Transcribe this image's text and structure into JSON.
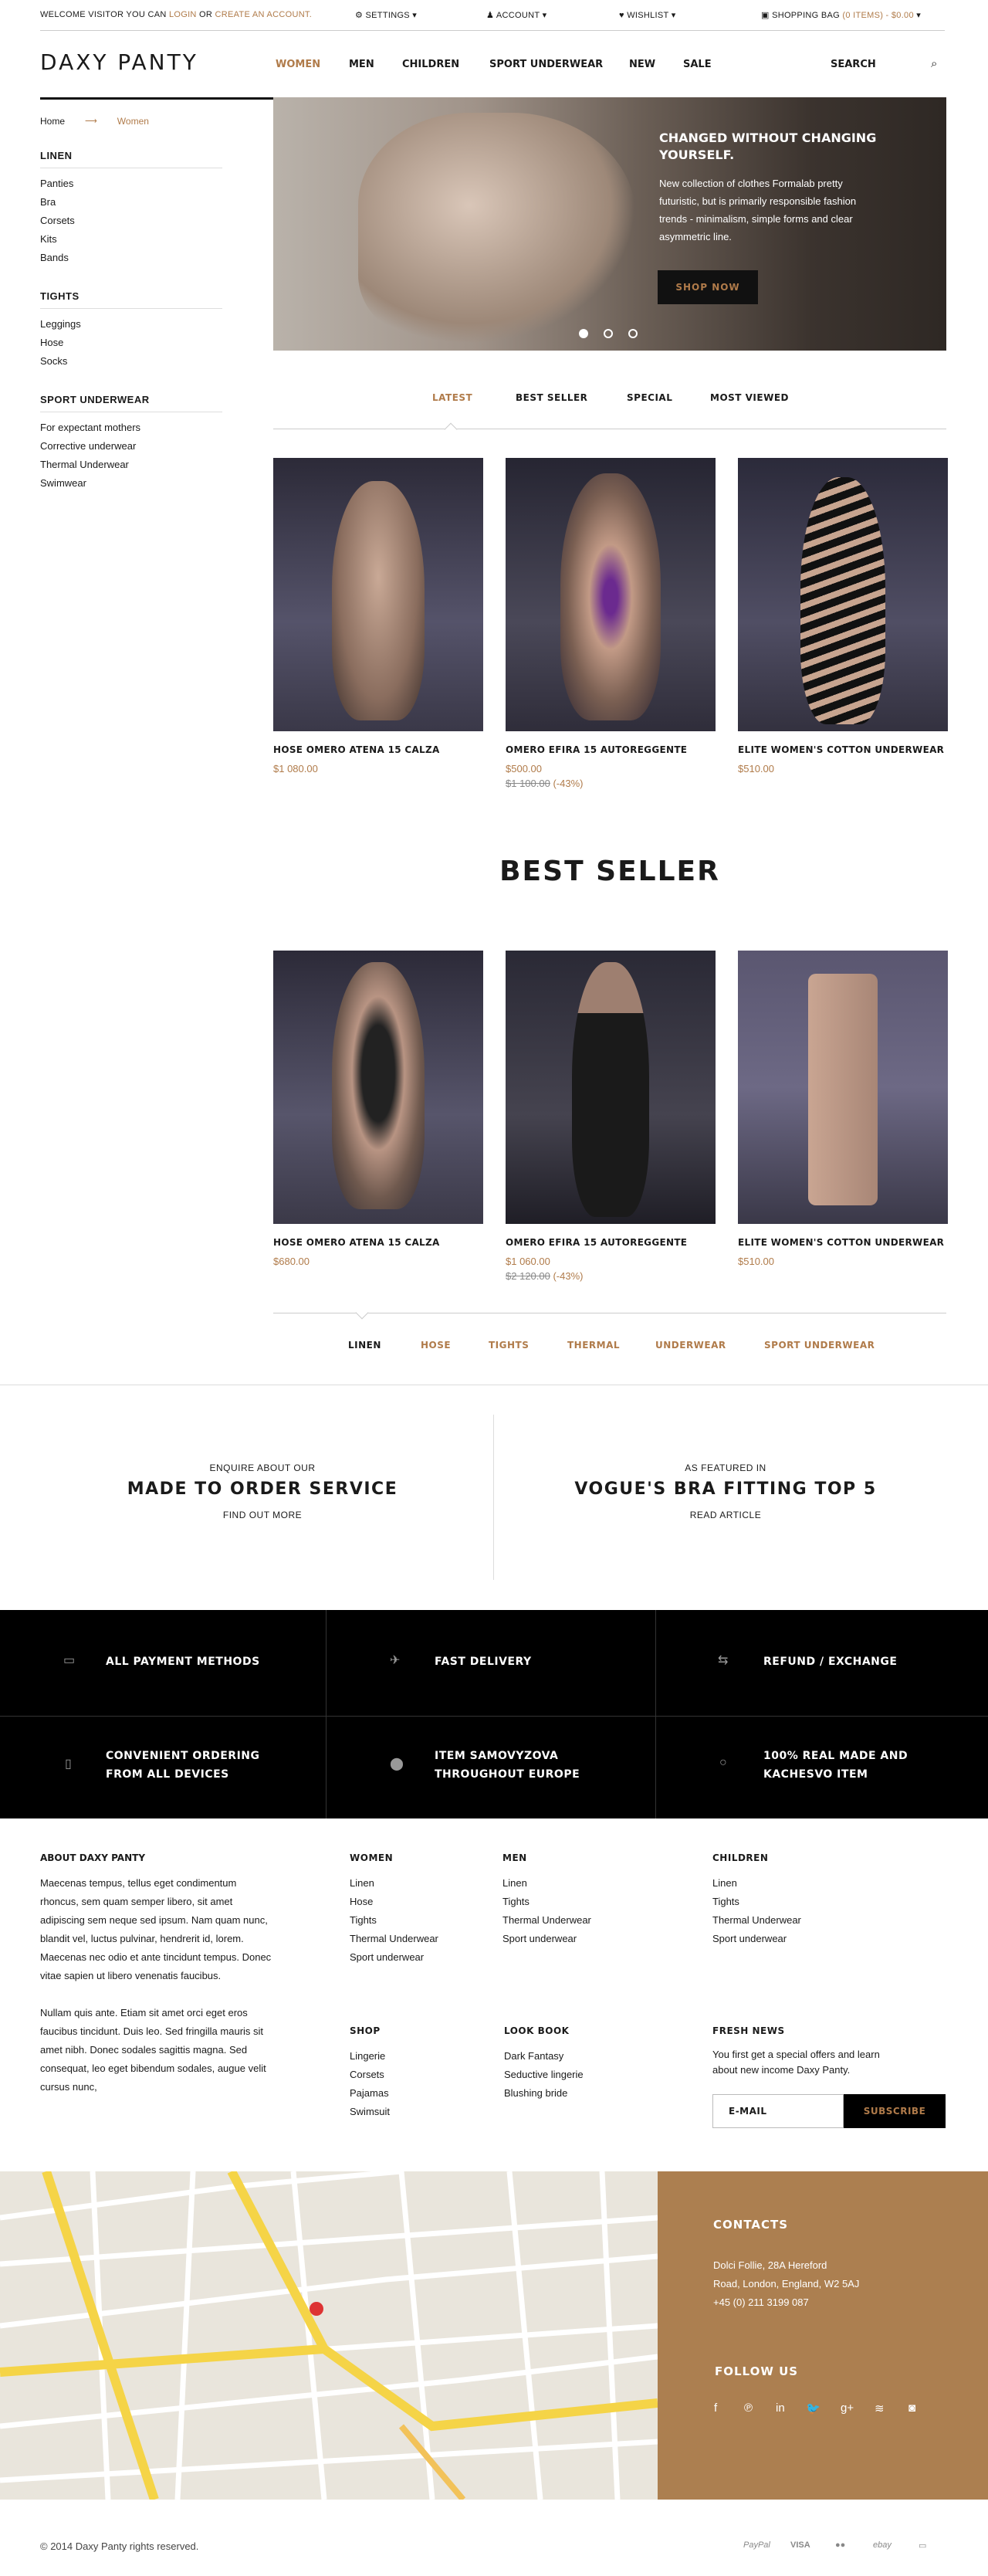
{
  "topbar": {
    "welcome": "WELCOME VISITOR YOU CAN ",
    "login": "LOGIN",
    "or": " OR ",
    "create": "CREATE AN ACCOUNT.",
    "settings": "SETTINGS",
    "account": "ACCOUNT",
    "wishlist": "WISHLIST",
    "bag": "SHOPPING BAG",
    "bag_count": "0 ITEMS) - $0.00"
  },
  "brand": "DAXY PANTY",
  "nav": [
    "WOMEN",
    "MEN",
    "CHILDREN",
    "SPORT UNDERWEAR",
    "NEW",
    "SALE"
  ],
  "search": "SEARCH",
  "breadcrumb": {
    "home": "Home",
    "current": "Women"
  },
  "sidebar": [
    {
      "title": "LINEN",
      "items": [
        "Panties",
        "Bra",
        "Corsets",
        "Kits",
        "Bands"
      ]
    },
    {
      "title": "TIGHTS",
      "items": [
        "Leggings",
        "Hose",
        "Socks"
      ]
    },
    {
      "title": "SPORT UNDERWEAR",
      "items": [
        "For expectant mothers",
        "Corrective underwear",
        "Thermal Underwear",
        "Swimwear"
      ]
    }
  ],
  "hero": {
    "title": "CHANGED WITHOUT CHANGING YOURSELF.",
    "text": "New collection of clothes Formalab pretty futuristic, but is primarily responsible fashion trends - minimalism, simple forms and clear asymmetric line.",
    "button": "SHOP NOW"
  },
  "tabs": [
    "LATEST",
    "BEST SELLER",
    "SPECIAL",
    "MOST VIEWED"
  ],
  "latest": [
    {
      "name": "HOSE OMERO ATENA 15 CALZA",
      "price": "$1 080.00",
      "old": "",
      "discount": ""
    },
    {
      "name": "OMERO EFIRA 15 AUTOREGGENTE",
      "price": "$500.00",
      "old": "$1 100.00",
      "discount": "(-43%)"
    },
    {
      "name": "ELITE WOMEN'S COTTON UNDERWEAR",
      "price": "$510.00",
      "old": "",
      "discount": ""
    }
  ],
  "bestseller_title": "BEST SELLER",
  "bestseller": [
    {
      "name": "HOSE OMERO ATENA 15 CALZA",
      "price": "$680.00",
      "old": "",
      "discount": ""
    },
    {
      "name": "OMERO EFIRA 15 AUTOREGGENTE",
      "price": "$1 060.00",
      "old": "$2 120.00",
      "discount": "(-43%)"
    },
    {
      "name": "ELITE WOMEN'S COTTON UNDERWEAR",
      "price": "$510.00",
      "old": "",
      "discount": ""
    }
  ],
  "categories": [
    "LINEN",
    "HOSE",
    "TIGHTS",
    "THERMAL",
    "UNDERWEAR",
    "SPORT UNDERWEAR"
  ],
  "promos": [
    {
      "small": "ENQUIRE ABOUT OUR",
      "big": "MADE TO ORDER SERVICE",
      "link": "FIND OUT MORE"
    },
    {
      "small": "AS FEATURED IN",
      "big": "VOGUE'S BRA FITTING TOP 5",
      "link": "READ ARTICLE"
    }
  ],
  "features": [
    {
      "icon": "card-icon",
      "l1": "ALL PAYMENT METHODS",
      "l2": ""
    },
    {
      "icon": "plane-icon",
      "l1": "FAST DELIVERY",
      "l2": ""
    },
    {
      "icon": "exchange-icon",
      "l1": "REFUND / EXCHANGE",
      "l2": ""
    },
    {
      "icon": "phone-icon",
      "l1": "CONVENIENT ORDERING",
      "l2": "FROM ALL DEVICES"
    },
    {
      "icon": "pin-icon",
      "l1": "ITEM SAMOVYZOVA",
      "l2": "THROUGHOUT EUROPE"
    },
    {
      "icon": "circle-icon",
      "l1": "100% REAL MADE AND",
      "l2": "KACHESVO ITEM"
    }
  ],
  "about": {
    "title": "ABOUT DAXY PANTY",
    "p1": "Maecenas tempus, tellus eget condimentum rhoncus, sem quam semper libero, sit amet adipiscing sem neque sed ipsum. Nam quam nunc, blandit vel, luctus pulvinar, hendrerit id, lorem. Maecenas nec odio et ante tincidunt tempus. Donec vitae sapien ut libero venenatis faucibus.",
    "p2": "Nullam quis ante. Etiam sit amet orci eget eros faucibus tincidunt. Duis leo. Sed fringilla mauris sit amet nibh. Donec sodales sagittis magna. Sed consequat, leo eget bibendum sodales, augue velit cursus nunc,"
  },
  "footer_cols": [
    {
      "title": "WOMEN",
      "items": [
        "Linen",
        "Hose",
        "Tights",
        "Thermal Underwear",
        "Sport underwear"
      ]
    },
    {
      "title": "MEN",
      "items": [
        "Linen",
        "Tights",
        "Thermal Underwear",
        "Sport underwear"
      ]
    },
    {
      "title": "CHILDREN",
      "items": [
        "Linen",
        "Tights",
        "Thermal Underwear",
        "Sport underwear"
      ]
    },
    {
      "title": "SHOP",
      "items": [
        "Lingerie",
        "Corsets",
        "Pajamas",
        "Swimsuit"
      ]
    },
    {
      "title": "LOOK BOOK",
      "items": [
        "Dark Fantasy",
        "Seductive lingerie",
        "Blushing bride"
      ]
    }
  ],
  "news": {
    "title": "FRESH NEWS",
    "text": "You first get a special offers and learn about new income Daxy Panty.",
    "placeholder": "E-MAIL",
    "button": "SUBSCRIBE"
  },
  "contacts": {
    "title": "CONTACTS",
    "address1": "Dolci Follie, 28A Hereford",
    "address2": "Road, London, England, W2 5AJ",
    "phone": "+45 (0) 211 3199 087",
    "follow": "FOLLOW US"
  },
  "social": [
    "f",
    "℗",
    "in",
    "🐦",
    "g+",
    "≋",
    "◙"
  ],
  "copyright": "© 2014 Daxy Panty rights reserved.",
  "payments": [
    "PayPal",
    "VISA",
    "●●",
    "ebay",
    "▭"
  ],
  "colors": {
    "accent": "#b07b4a",
    "dark": "#000000",
    "contacts_bg": "#ac7f50"
  }
}
